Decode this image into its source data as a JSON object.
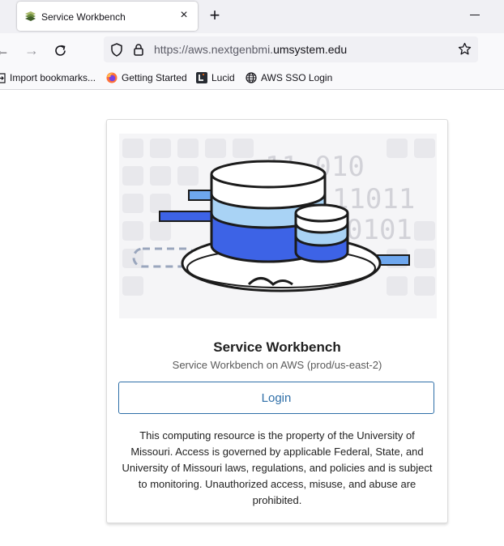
{
  "browser": {
    "tab_title": "Service Workbench",
    "tab_close": "×",
    "new_tab": "+",
    "url_prefix": "https://aws.nextgenbmi.",
    "url_domain": "umsystem.edu",
    "bookmarks": [
      {
        "label": "Import bookmarks...",
        "icon": "import-icon"
      },
      {
        "label": "Getting Started",
        "icon": "firefox-icon"
      },
      {
        "label": "Lucid",
        "icon": "lucid-icon"
      },
      {
        "label": "AWS SSO Login",
        "icon": "globe-icon"
      }
    ]
  },
  "hero": {
    "binary_lines": [
      "11 010",
      "0111011",
      "0101"
    ],
    "colors": {
      "dark_blue": "#3d63e6",
      "light_blue": "#a9d3f5",
      "outline": "#1b1b1b"
    }
  },
  "page": {
    "title": "Service Workbench",
    "subtitle": "Service Workbench on AWS (prod/us-east-2)",
    "login_label": "Login",
    "notice": "This computing resource is the property of the University of Missouri. Access is governed by applicable Federal, State, and University of Missouri laws, regulations, and policies and is subject to monitoring. Unauthorized access, misuse, and abuse are prohibited."
  }
}
